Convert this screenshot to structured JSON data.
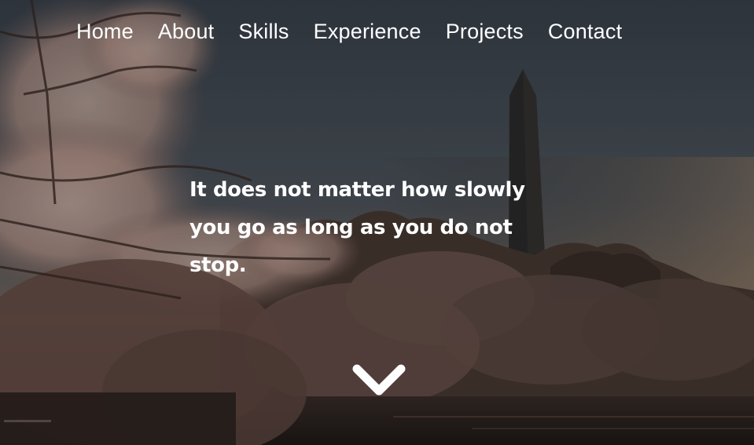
{
  "nav": {
    "items": [
      {
        "label": "Home"
      },
      {
        "label": "About"
      },
      {
        "label": "Skills"
      },
      {
        "label": "Experience"
      },
      {
        "label": "Projects"
      },
      {
        "label": "Contact"
      }
    ]
  },
  "hero": {
    "quote": "It does not matter how slowly you go as long as you do not stop.",
    "scroll_icon": "chevron-down-icon",
    "background": "cherry blossoms with obelisk at dusk"
  },
  "colors": {
    "text": "#ffffff",
    "sky_top": "#3e4853",
    "sky_bottom": "#7b6d62",
    "blossom": "#c7a89e",
    "foliage_dark": "#3a2d29"
  }
}
